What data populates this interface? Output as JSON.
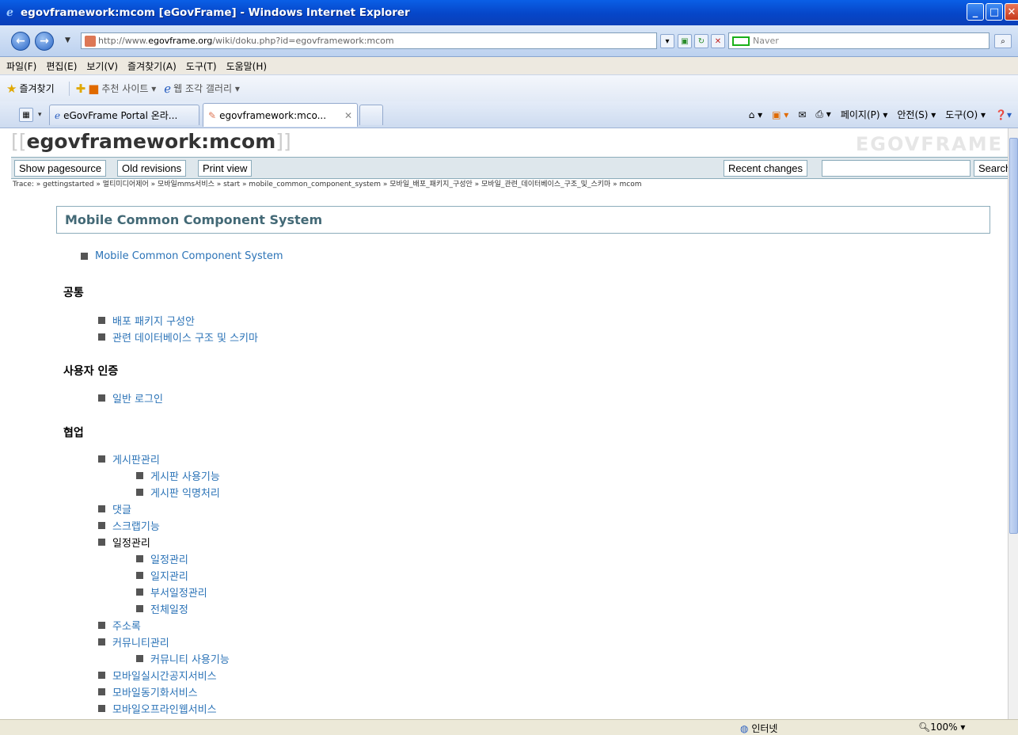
{
  "window": {
    "title": "egovframework:mcom [eGovFrame] - Windows Internet Explorer"
  },
  "navbar": {
    "url_prefix": "http://www.",
    "url_domain": "egovframe.org",
    "url_path": "/wiki/doku.php?id=egovframework:mcom",
    "search_placeholder": "Naver"
  },
  "menu": [
    "파일(F)",
    "편집(E)",
    "보기(V)",
    "즐겨찾기(A)",
    "도구(T)",
    "도움말(H)"
  ],
  "favorites": {
    "label": "즐겨찾기",
    "suggested": "추천 사이트 ▾",
    "gallery": "웹 조각 갤러리 ▾"
  },
  "tabs": [
    {
      "label": "eGovFrame Portal 온라...",
      "active": false
    },
    {
      "label": "egovframework:mco...",
      "active": true
    }
  ],
  "command_bar": [
    "페이지(P) ▾",
    "안전(S) ▾",
    "도구(O) ▾"
  ],
  "page": {
    "title_open": "[[",
    "title": "egovframework:mcom",
    "title_close": "]]",
    "logo": "EGOVFRAME",
    "buttons": {
      "show_source": "Show pagesource",
      "old_revisions": "Old revisions",
      "print_view": "Print view",
      "recent_changes": "Recent changes",
      "search": "Search"
    },
    "trace": "Trace: » gettingstarted » 멀티미디어제어 » 모바일mms서비스 » start » mobile_common_component_system » 모바일_배포_패키지_구성안 » 모바일_관련_데이터베이스_구조_및_스키마 » mcom",
    "section_title": "Mobile Common Component System",
    "top_link": "Mobile Common Component System",
    "sec_common": "공통",
    "common_items": [
      "배포 패키지 구성안",
      "관련 데이터베이스 구조 및 스키마"
    ],
    "sec_auth": "사용자 인증",
    "auth_items": [
      "일반 로그인"
    ],
    "sec_collab": "협업",
    "collab": {
      "board": "게시판관리",
      "board_sub": [
        "게시판 사용기능",
        "게시판 익명처리"
      ],
      "comment": "댓글",
      "scrap": "스크랩기능",
      "schedule": "일정관리",
      "schedule_sub": [
        "일정관리",
        "일지관리",
        "부서일정관리",
        "전체일정"
      ],
      "address": "주소록",
      "community": "커뮤니티관리",
      "community_sub": [
        "커뮤니티 사용기능"
      ],
      "realtime": "모바일실시간공지서비스",
      "sync": "모바일동기화서비스",
      "offline": "모바일오프라인웹서비스"
    }
  },
  "status": {
    "zone": "인터넷",
    "zoom": "100%"
  }
}
